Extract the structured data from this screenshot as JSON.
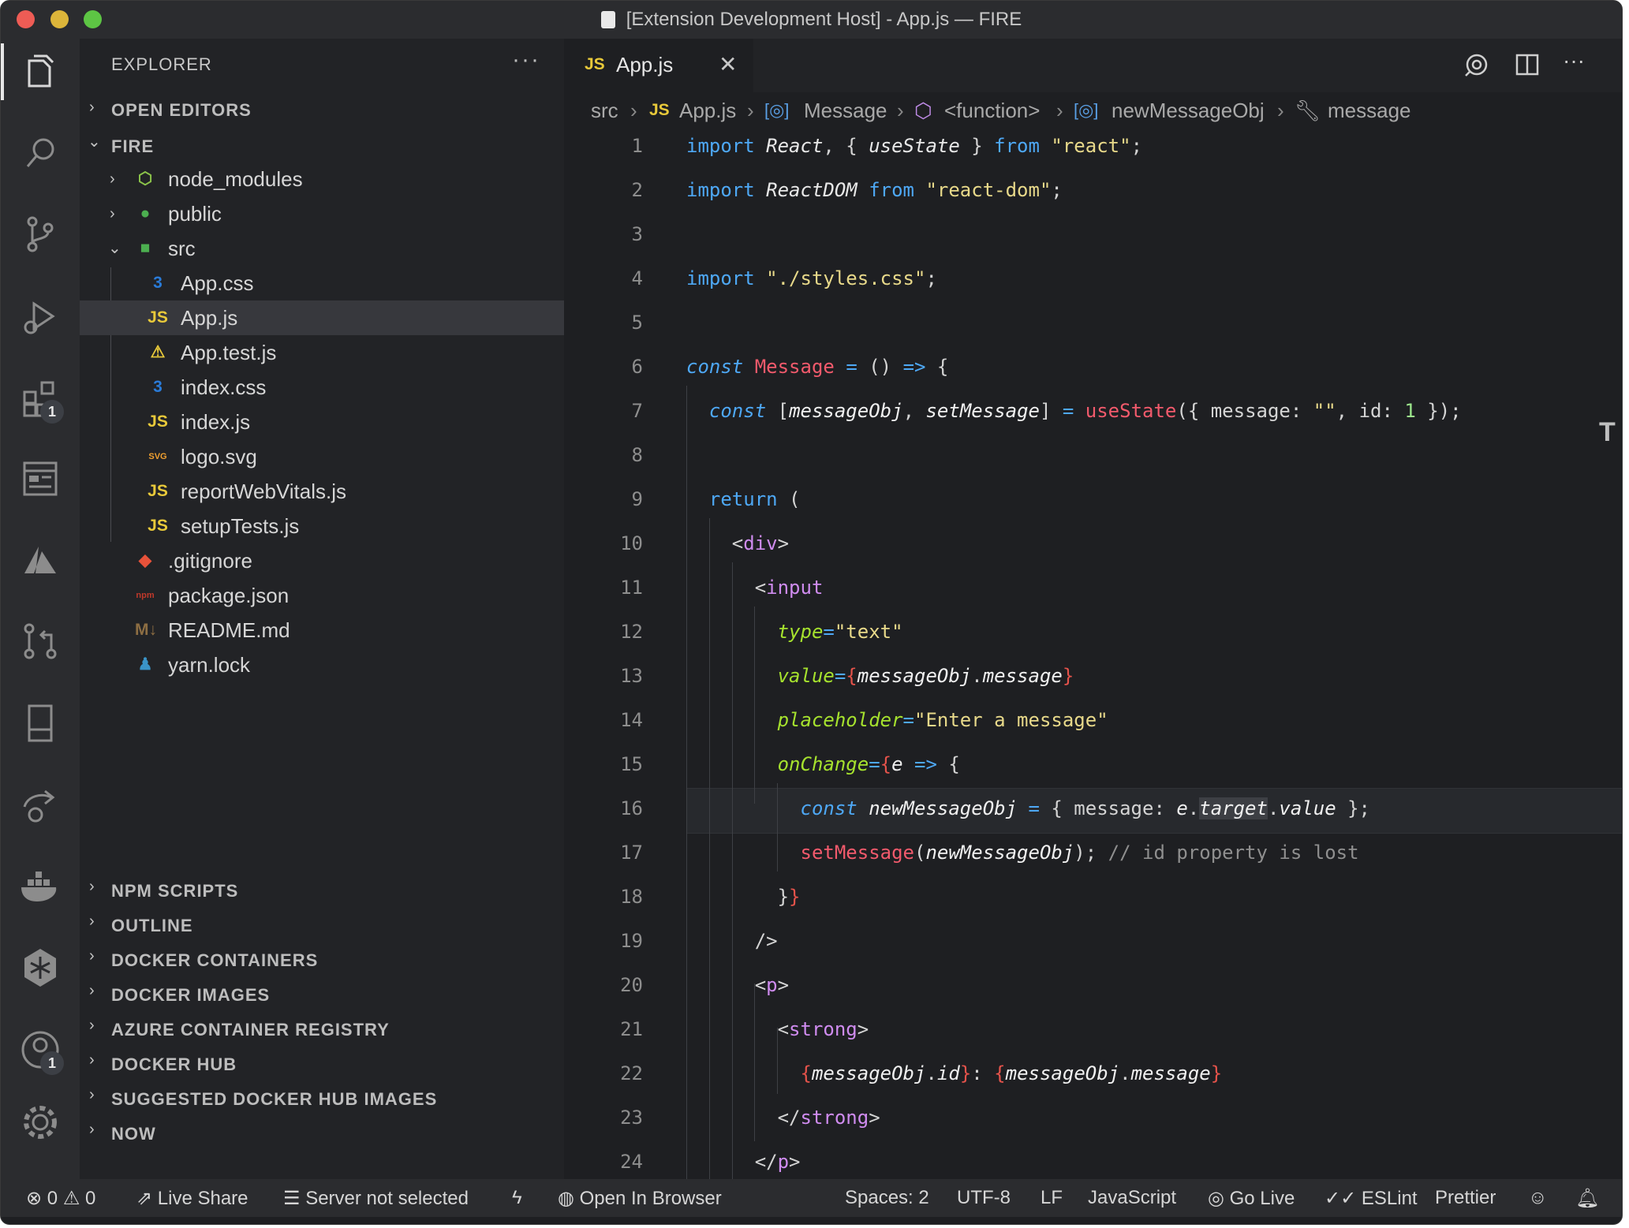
{
  "window": {
    "title": "[Extension Development Host] - App.js — FIRE",
    "traffic_lights": {
      "close": "#ee5c55",
      "minimize": "#dcb53a",
      "maximize": "#5dc544"
    }
  },
  "activity_bar": {
    "items": [
      {
        "icon": "files-icon"
      },
      {
        "icon": "search-icon"
      },
      {
        "icon": "source-control-icon"
      },
      {
        "icon": "run-debug-icon"
      },
      {
        "icon": "extensions-icon",
        "badge": "1"
      },
      {
        "icon": "remote-explorer-icon"
      },
      {
        "icon": "azure-icon"
      },
      {
        "icon": "pull-requests-icon"
      },
      {
        "icon": "bookmark-panel-icon"
      },
      {
        "icon": "live-share-icon"
      },
      {
        "icon": "docker-icon"
      },
      {
        "icon": "kubernetes-icon"
      },
      {
        "icon": "accounts-icon",
        "badge": "1"
      },
      {
        "icon": "settings-gear-icon"
      }
    ]
  },
  "sidebar": {
    "title": "EXPLORER",
    "more": "···",
    "open_editors": "OPEN EDITORS",
    "workspace": "FIRE",
    "tree": [
      {
        "label": "node_modules",
        "icon": "folder-node-icon",
        "icon_text": "⬡",
        "icon_color": "#8bc34a"
      },
      {
        "label": "public",
        "icon": "folder-public-icon",
        "icon_text": "●",
        "icon_color": "#4caf50"
      },
      {
        "label": "src",
        "icon": "folder-src-icon",
        "icon_text": "■",
        "icon_color": "#4caf50"
      },
      {
        "label": "App.css",
        "icon": "css-file-icon",
        "icon_text": "3",
        "icon_color": "#2a7bd8"
      },
      {
        "label": "App.js",
        "icon": "js-file-icon",
        "icon_text": "JS",
        "icon_color": "#e8c93a"
      },
      {
        "label": "App.test.js",
        "icon": "test-js-file-icon",
        "icon_text": "⚠",
        "icon_color": "#e8c93a"
      },
      {
        "label": "index.css",
        "icon": "css-file-icon",
        "icon_text": "3",
        "icon_color": "#2a7bd8"
      },
      {
        "label": "index.js",
        "icon": "js-file-icon",
        "icon_text": "JS",
        "icon_color": "#e8c93a"
      },
      {
        "label": "logo.svg",
        "icon": "svg-file-icon",
        "icon_text": "SVG",
        "icon_color": "#f0a030"
      },
      {
        "label": "reportWebVitals.js",
        "icon": "js-file-icon",
        "icon_text": "JS",
        "icon_color": "#e8c93a"
      },
      {
        "label": "setupTests.js",
        "icon": "js-file-icon",
        "icon_text": "JS",
        "icon_color": "#e8c93a"
      },
      {
        "label": ".gitignore",
        "icon": "git-file-icon",
        "icon_text": "◆",
        "icon_color": "#e8523a"
      },
      {
        "label": "package.json",
        "icon": "npm-file-icon",
        "icon_text": "npm",
        "icon_color": "#c0392b"
      },
      {
        "label": "README.md",
        "icon": "markdown-file-icon",
        "icon_text": "M↓",
        "icon_color": "#8d6e43"
      },
      {
        "label": "yarn.lock",
        "icon": "yarn-file-icon",
        "icon_text": "♟",
        "icon_color": "#3a94c8"
      }
    ],
    "sections": [
      "NPM SCRIPTS",
      "OUTLINE",
      "DOCKER CONTAINERS",
      "DOCKER IMAGES",
      "AZURE CONTAINER REGISTRY",
      "DOCKER HUB",
      "SUGGESTED DOCKER HUB IMAGES",
      "NOW"
    ]
  },
  "tab": {
    "lang": "JS",
    "name": "App.js",
    "close": "✕"
  },
  "breadcrumb": {
    "items": [
      "src",
      "JS",
      "App.js",
      "Message",
      "<function>",
      "newMessageObj",
      "message"
    ]
  },
  "editor": {
    "line_numbers": [
      "1",
      "2",
      "3",
      "4",
      "5",
      "6",
      "7",
      "8",
      "9",
      "10",
      "11",
      "12",
      "13",
      "14",
      "15",
      "16",
      "17",
      "18",
      "19",
      "20",
      "21",
      "22",
      "23",
      "24"
    ]
  },
  "status_bar": {
    "errors": "0",
    "warnings": "0",
    "live_share": "Live Share",
    "server": "Server not selected",
    "open_in_browser": "Open In Browser",
    "spaces": "Spaces: 2",
    "encoding": "UTF-8",
    "eol": "LF",
    "language": "JavaScript",
    "go_live": "Go Live",
    "eslint": "ESLint",
    "prettier": "Prettier"
  }
}
